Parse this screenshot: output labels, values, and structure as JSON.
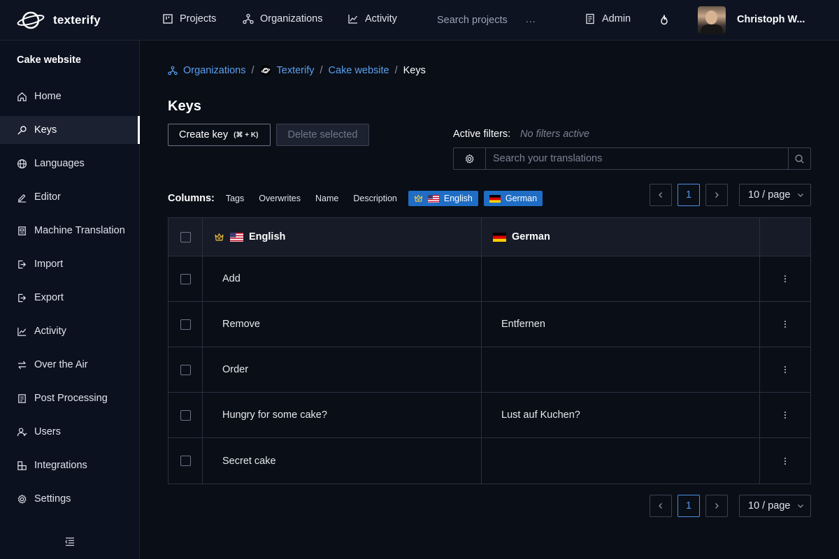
{
  "topbar": {
    "logo_text": "texterify",
    "nav": [
      {
        "label": "Projects",
        "icon": "projects-icon"
      },
      {
        "label": "Organizations",
        "icon": "organizations-icon"
      },
      {
        "label": "Activity",
        "icon": "activity-icon"
      }
    ],
    "search_label": "Search projects",
    "search_more": "...",
    "admin_label": "Admin",
    "user_name": "Christoph W..."
  },
  "sidebar": {
    "project_name": "Cake website",
    "items": [
      {
        "label": "Home",
        "icon": "home-icon"
      },
      {
        "label": "Keys",
        "icon": "key-icon",
        "active": true
      },
      {
        "label": "Languages",
        "icon": "globe-icon"
      },
      {
        "label": "Editor",
        "icon": "edit-icon"
      },
      {
        "label": "Machine Translation",
        "icon": "robot-icon"
      },
      {
        "label": "Import",
        "icon": "import-icon"
      },
      {
        "label": "Export",
        "icon": "export-icon"
      },
      {
        "label": "Activity",
        "icon": "activity-icon"
      },
      {
        "label": "Over the Air",
        "icon": "swap-icon"
      },
      {
        "label": "Post Processing",
        "icon": "document-icon"
      },
      {
        "label": "Users",
        "icon": "users-icon"
      },
      {
        "label": "Integrations",
        "icon": "integrations-icon"
      },
      {
        "label": "Settings",
        "icon": "settings-icon"
      }
    ]
  },
  "breadcrumb": {
    "items": [
      "Organizations",
      "Texterify",
      "Cake website"
    ],
    "current": "Keys",
    "separator": "/"
  },
  "page": {
    "title": "Keys",
    "create_label": "Create key",
    "create_shortcut": "(⌘ + K)",
    "delete_label": "Delete selected",
    "filters_label": "Active filters:",
    "filters_value": "No filters active",
    "search_placeholder": "Search your translations"
  },
  "columns": {
    "label": "Columns:",
    "chips": [
      "Tags",
      "Overwrites",
      "Name",
      "Description"
    ],
    "active_chips": [
      "English",
      "German"
    ]
  },
  "pagination": {
    "current_page": "1",
    "page_size": "10 / page"
  },
  "table": {
    "headers": [
      "English",
      "German"
    ],
    "rows": [
      {
        "en": "Add",
        "de": ""
      },
      {
        "en": "Remove",
        "de": "Entfernen"
      },
      {
        "en": "Order",
        "de": ""
      },
      {
        "en": "Hungry for some cake?",
        "de": "Lust auf Kuchen?"
      },
      {
        "en": "Secret cake",
        "de": ""
      }
    ]
  },
  "colors": {
    "accent": "#1f6dc4",
    "link": "#5aa0f0",
    "background": "#0a0e17"
  }
}
